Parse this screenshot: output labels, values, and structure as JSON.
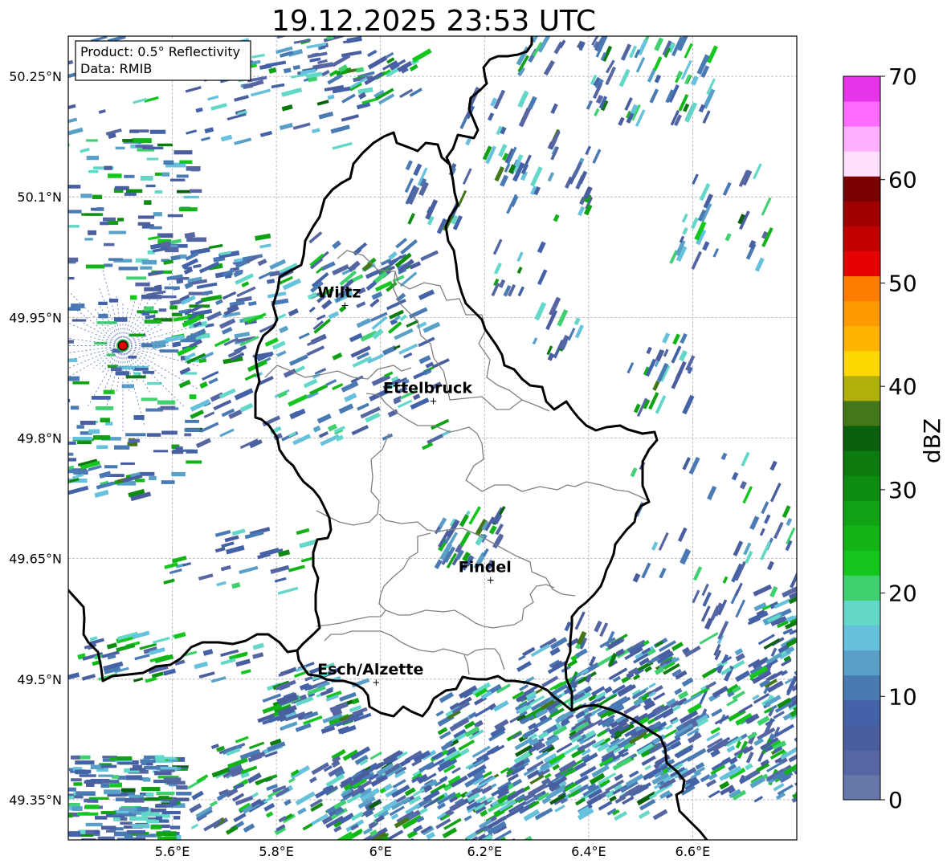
{
  "title": "19.12.2025 23:53 UTC",
  "info_box": {
    "product": "Product: 0.5° Reflectivity",
    "data": "Data: RMIB"
  },
  "map": {
    "lon_range": [
      5.4,
      6.8
    ],
    "lat_range": [
      49.3,
      50.3
    ],
    "lon_ticks": [
      {
        "value": 5.6,
        "label": "5.6°E"
      },
      {
        "value": 5.8,
        "label": "5.8°E"
      },
      {
        "value": 6.0,
        "label": "6°E"
      },
      {
        "value": 6.2,
        "label": "6.2°E"
      },
      {
        "value": 6.4,
        "label": "6.4°E"
      },
      {
        "value": 6.6,
        "label": "6.6°E"
      }
    ],
    "lat_ticks": [
      {
        "value": 50.25,
        "label": "50.25°N"
      },
      {
        "value": 50.1,
        "label": "50.1°N"
      },
      {
        "value": 49.95,
        "label": "49.95°N"
      },
      {
        "value": 49.8,
        "label": "49.8°N"
      },
      {
        "value": 49.65,
        "label": "49.65°N"
      },
      {
        "value": 49.5,
        "label": "49.5°N"
      },
      {
        "value": 49.35,
        "label": "49.35°N"
      }
    ],
    "cities": [
      {
        "name": "Wiltz",
        "lon": 5.93,
        "lat": 49.966
      },
      {
        "name": "Ettelbruck",
        "lon": 6.1,
        "lat": 49.847
      },
      {
        "name": "Findel",
        "lon": 6.21,
        "lat": 49.624
      },
      {
        "name": "Esch/Alzette",
        "lon": 5.99,
        "lat": 49.497
      }
    ],
    "radar_site": {
      "lon": 5.505,
      "lat": 49.915
    },
    "border_color": "#000000",
    "canton_color": "#808080"
  },
  "colorbar": {
    "label": "dBZ",
    "min": 0,
    "max": 70,
    "ticks": [
      "0",
      "10",
      "20",
      "30",
      "40",
      "50",
      "60",
      "70"
    ],
    "colors": [
      "#6677aa",
      "#5566a2",
      "#4a5e9f",
      "#4462a8",
      "#4a7ab4",
      "#58a0c8",
      "#66c1dc",
      "#64d8c8",
      "#40d070",
      "#14c61e",
      "#12b418",
      "#10a214",
      "#0e8c10",
      "#0c7a0e",
      "#0a600c",
      "#44761a",
      "#b0b00a",
      "#ffd700",
      "#ffb400",
      "#ff9a00",
      "#ff7e00",
      "#e60000",
      "#c20000",
      "#a00000",
      "#780000",
      "#ffe0ff",
      "#ffb0ff",
      "#ff6cff",
      "#e834e8"
    ]
  }
}
